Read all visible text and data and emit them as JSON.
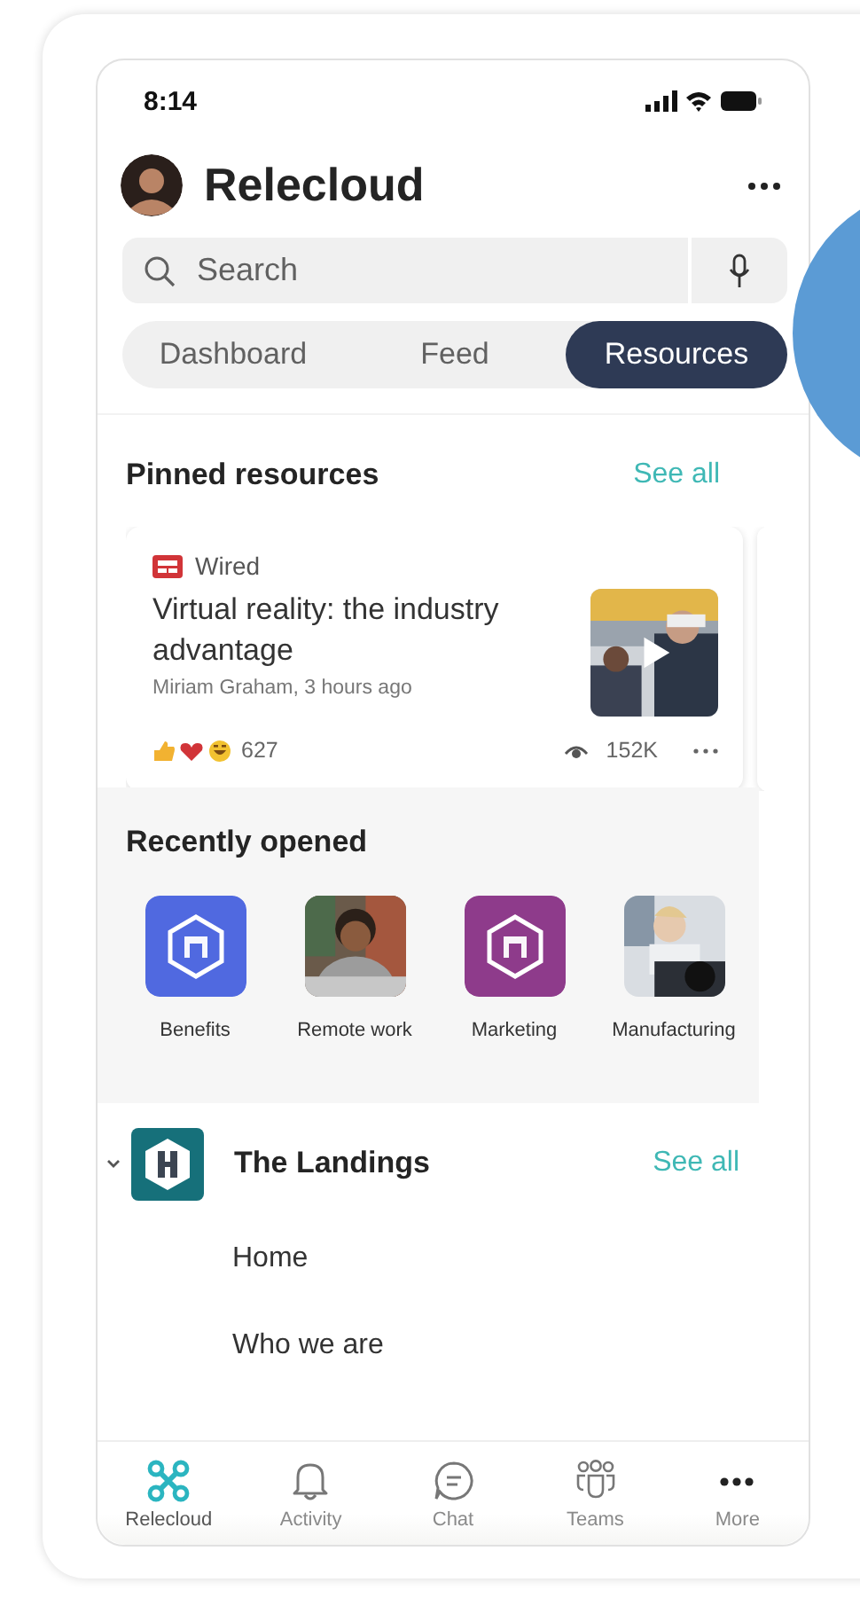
{
  "status_bar": {
    "time": "8:14"
  },
  "header": {
    "title": "Relecloud"
  },
  "search": {
    "placeholder": "Search"
  },
  "tabs": [
    {
      "label": "Dashboard",
      "selected": false
    },
    {
      "label": "Feed",
      "selected": false
    },
    {
      "label": "Resources",
      "selected": true
    }
  ],
  "pinned": {
    "title": "Pinned resources",
    "see_all": "See all",
    "card": {
      "source": "Wired",
      "title": "Virtual reality: the industry advantage",
      "meta": "Miriam Graham, 3 hours ago",
      "reactions": "627",
      "views": "152K",
      "kind": "picture"
    }
  },
  "recent": {
    "title": "Recently opened",
    "items": [
      {
        "label": "Benefits",
        "kind": "app",
        "color": "#5069e0"
      },
      {
        "label": "Remote work",
        "kind": "picture"
      },
      {
        "label": "Marketing",
        "kind": "app",
        "color": "#8e3b8b"
      },
      {
        "label": "Manufacturing",
        "kind": "picture"
      }
    ]
  },
  "site": {
    "name": "The Landings",
    "see_all": "See all",
    "expanded": true,
    "links": [
      {
        "label": "Home"
      },
      {
        "label": "Who we are"
      }
    ]
  },
  "nav": [
    {
      "label": "Relecloud",
      "selected": true
    },
    {
      "label": "Activity",
      "selected": false
    },
    {
      "label": "Chat",
      "selected": false
    },
    {
      "label": "Teams",
      "selected": false
    },
    {
      "label": "More",
      "selected": false
    }
  ]
}
